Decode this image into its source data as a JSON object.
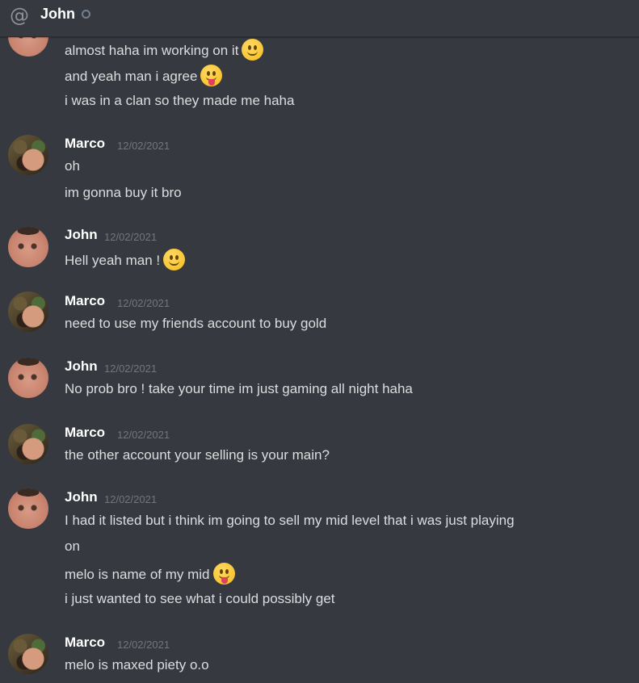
{
  "header": {
    "channel_title": "John"
  },
  "messages": {
    "intro_lines": [
      "almost haha im working on it",
      "and yeah man i agree",
      "i was in a clan so they made me haha"
    ],
    "groups": [
      {
        "author": "Marco",
        "timestamp": "12/02/2021",
        "lines": [
          "oh",
          "im gonna buy it bro"
        ]
      },
      {
        "author": "John",
        "timestamp": "12/02/2021",
        "lines": [
          "Hell yeah man !"
        ]
      },
      {
        "author": "Marco",
        "timestamp": "12/02/2021",
        "lines": [
          "need to use my friends account to buy gold"
        ]
      },
      {
        "author": "John",
        "timestamp": "12/02/2021",
        "lines": [
          "No prob bro ! take your time im just gaming all night haha"
        ]
      },
      {
        "author": "Marco",
        "timestamp": "12/02/2021",
        "lines": [
          "the other account your selling is your main?"
        ]
      },
      {
        "author": "John",
        "timestamp": "12/02/2021",
        "lines": [
          "I had it listed but i think im going to sell my mid level that i was just playing",
          "on",
          "melo is name of my mid",
          "i just wanted to see what i could possibly get"
        ]
      },
      {
        "author": "Marco",
        "timestamp": "12/02/2021",
        "lines": [
          "melo is maxed piety o.o"
        ]
      }
    ]
  },
  "icons": {
    "at": "at-sign-icon",
    "status": "offline-status-icon",
    "smile": "slightly-smiling-face-emoji",
    "tongue": "face-with-tongue-emoji"
  }
}
